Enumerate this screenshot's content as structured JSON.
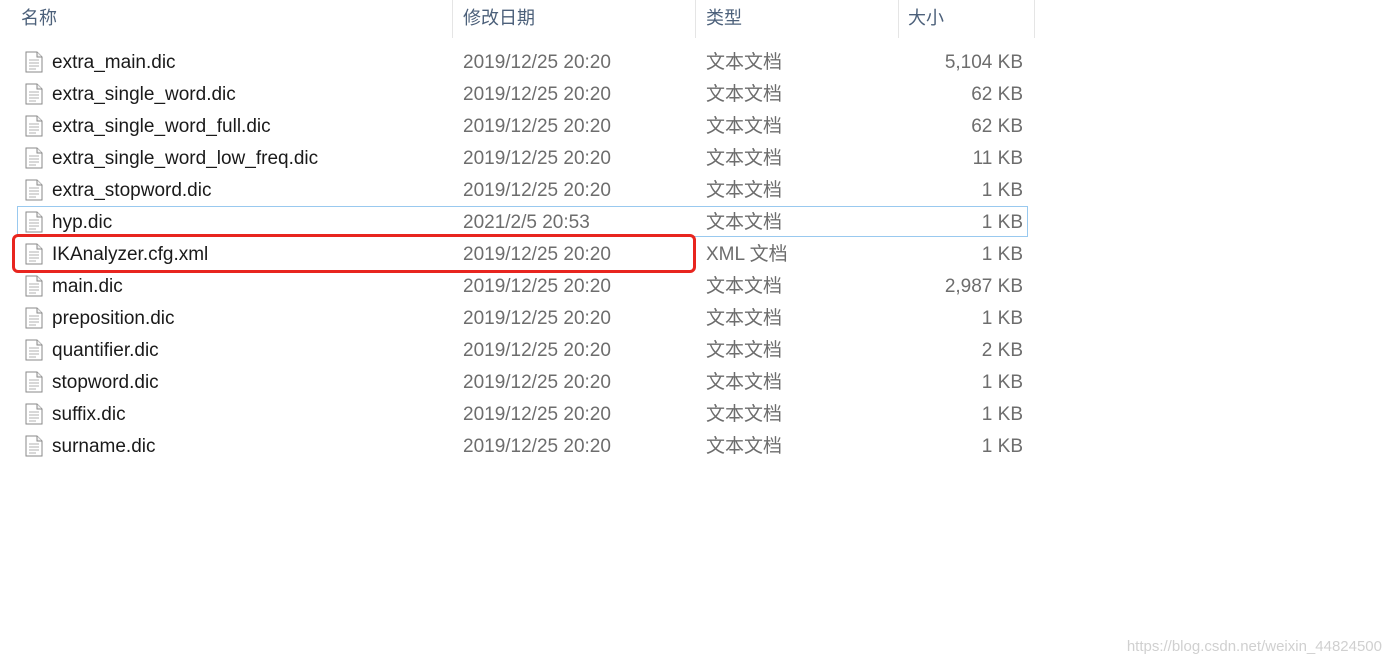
{
  "header": {
    "name": "名称",
    "date": "修改日期",
    "type": "类型",
    "size": "大小",
    "sort_indicator": "^"
  },
  "files": [
    {
      "name": "extra_main.dic",
      "date": "2019/12/25 20:20",
      "type": "文本文档",
      "size": "5,104 KB"
    },
    {
      "name": "extra_single_word.dic",
      "date": "2019/12/25 20:20",
      "type": "文本文档",
      "size": "62 KB"
    },
    {
      "name": "extra_single_word_full.dic",
      "date": "2019/12/25 20:20",
      "type": "文本文档",
      "size": "62 KB"
    },
    {
      "name": "extra_single_word_low_freq.dic",
      "date": "2019/12/25 20:20",
      "type": "文本文档",
      "size": "11 KB"
    },
    {
      "name": "extra_stopword.dic",
      "date": "2019/12/25 20:20",
      "type": "文本文档",
      "size": "1 KB"
    },
    {
      "name": "hyp.dic",
      "date": "2021/2/5 20:53",
      "type": "文本文档",
      "size": "1 KB"
    },
    {
      "name": "IKAnalyzer.cfg.xml",
      "date": "2019/12/25 20:20",
      "type": "XML 文档",
      "size": "1 KB"
    },
    {
      "name": "main.dic",
      "date": "2019/12/25 20:20",
      "type": "文本文档",
      "size": "2,987 KB"
    },
    {
      "name": "preposition.dic",
      "date": "2019/12/25 20:20",
      "type": "文本文档",
      "size": "1 KB"
    },
    {
      "name": "quantifier.dic",
      "date": "2019/12/25 20:20",
      "type": "文本文档",
      "size": "2 KB"
    },
    {
      "name": "stopword.dic",
      "date": "2019/12/25 20:20",
      "type": "文本文档",
      "size": "1 KB"
    },
    {
      "name": "suffix.dic",
      "date": "2019/12/25 20:20",
      "type": "文本文档",
      "size": "1 KB"
    },
    {
      "name": "surname.dic",
      "date": "2019/12/25 20:20",
      "type": "文本文档",
      "size": "1 KB"
    }
  ],
  "icons": {
    "file": "text-file-icon"
  },
  "colors": {
    "selection_border": "#99c9ef",
    "annotation_red": "#e8251f",
    "header_text": "#4c607a"
  },
  "watermark": "https://blog.csdn.net/weixin_44824500"
}
